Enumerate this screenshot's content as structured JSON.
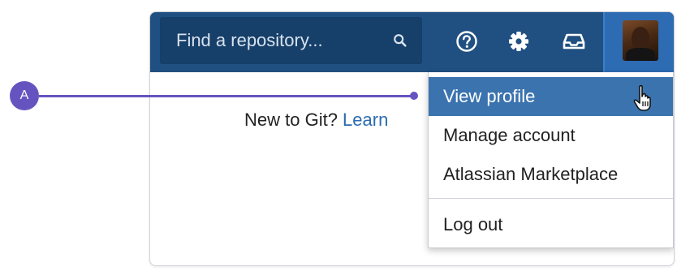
{
  "header": {
    "search": {
      "placeholder": "Find a repository..."
    },
    "icons": [
      "search-icon",
      "help-icon",
      "gear-icon",
      "inbox-icon",
      "avatar"
    ]
  },
  "content": {
    "prompt_text": "New to Git? ",
    "learn_link": "Learn"
  },
  "profile_menu": {
    "items": [
      {
        "label": "View profile",
        "active": true
      },
      {
        "label": "Manage account",
        "active": false
      },
      {
        "label": "Atlassian Marketplace",
        "active": false
      },
      {
        "label": "Log out",
        "active": false
      }
    ]
  },
  "annotation": {
    "label": "A"
  },
  "colors": {
    "nav_bg": "#205081",
    "search_bg": "#163f69",
    "avatar_area_bg": "#2d6bb3",
    "menu_active_bg": "#3b73af",
    "link": "#2b6cb0",
    "annotation": "#6554c0"
  }
}
